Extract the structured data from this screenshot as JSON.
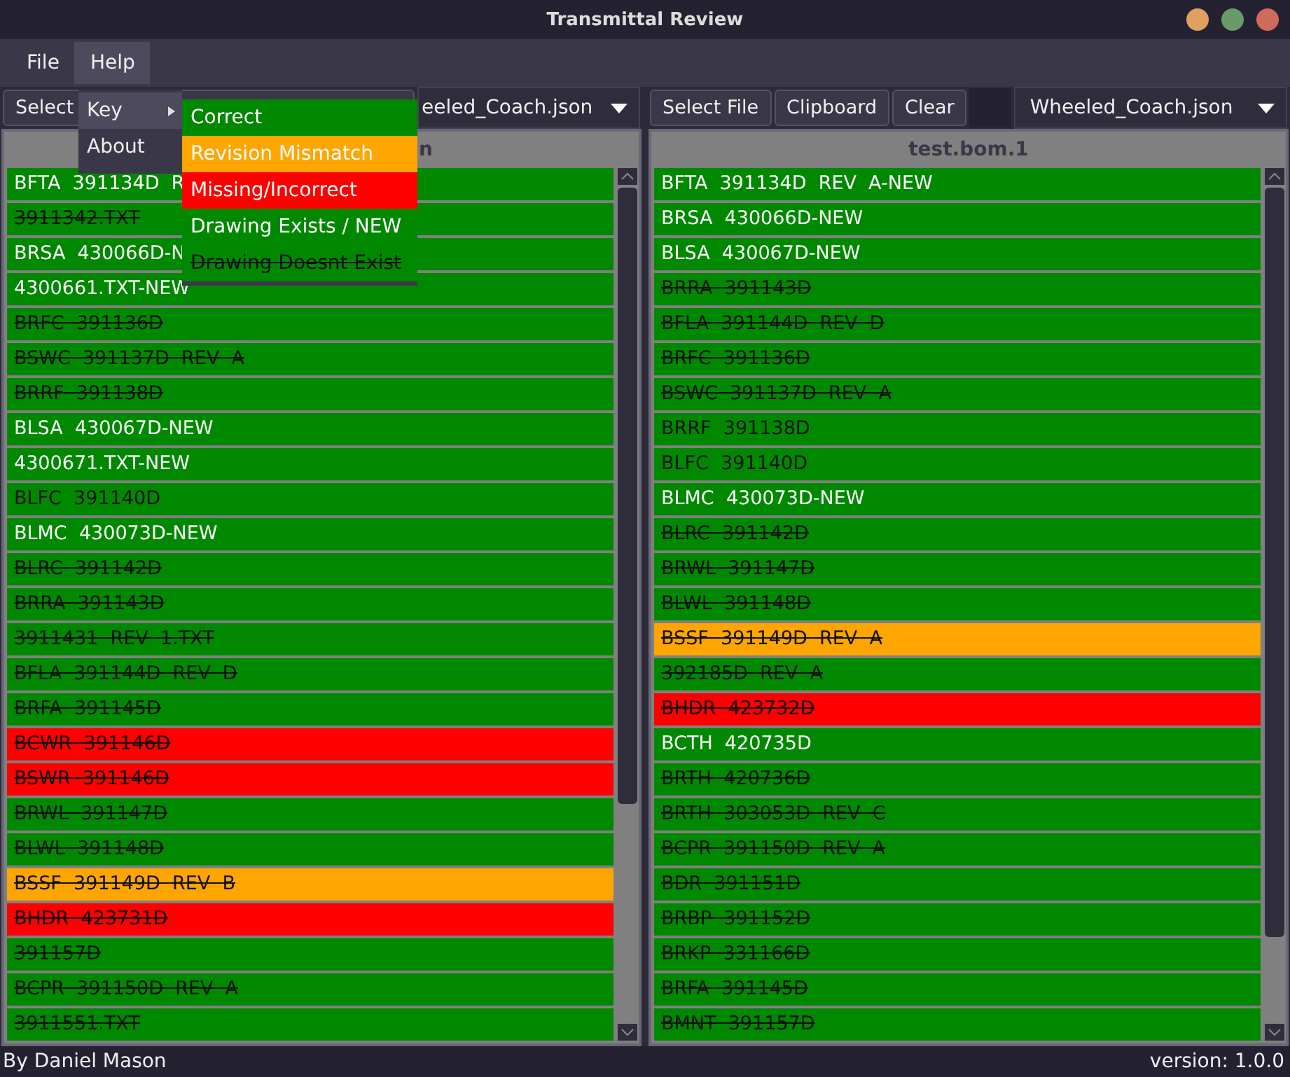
{
  "window": {
    "title": "Transmittal Review"
  },
  "menu": [
    {
      "label": "File",
      "selected": false
    },
    {
      "label": "Help",
      "selected": true
    }
  ],
  "help_menu": [
    {
      "label": "Key",
      "submenu": true,
      "selected": true
    },
    {
      "label": "About",
      "submenu": false,
      "selected": false
    }
  ],
  "key_submenu": [
    {
      "label": "Correct",
      "color": "#008800",
      "kind": "new"
    },
    {
      "label": "Revision Mismatch",
      "color": "#ffa500",
      "kind": "new"
    },
    {
      "label": "Missing/Incorrect",
      "color": "#ff0000",
      "kind": "new"
    },
    {
      "label": "Drawing Exists / NEW",
      "color": "#008800",
      "kind": "new"
    },
    {
      "label": "Drawing Doesnt Exist",
      "color": "#008800",
      "kind": "struck"
    }
  ],
  "left": {
    "buttons": [
      "Select"
    ],
    "file_select": "eeled_Coach.json",
    "header": "n",
    "rows": [
      {
        "text": "BFTA  391134D  R",
        "color": "#008800",
        "kind": "new"
      },
      {
        "text": "3911342.TXT",
        "color": "#008800",
        "kind": "struck"
      },
      {
        "text": "BRSA  430066D-N",
        "color": "#008800",
        "kind": "new"
      },
      {
        "text": "4300661.TXT-NEW",
        "color": "#008800",
        "kind": "new"
      },
      {
        "text": "BRFC  391136D",
        "color": "#008800",
        "kind": "struck"
      },
      {
        "text": "BSWC  391137D  REV  A",
        "color": "#008800",
        "kind": "struck"
      },
      {
        "text": "BRRF  391138D",
        "color": "#008800",
        "kind": "struck"
      },
      {
        "text": "BLSA  430067D-NEW",
        "color": "#008800",
        "kind": "new"
      },
      {
        "text": "4300671.TXT-NEW",
        "color": "#008800",
        "kind": "new"
      },
      {
        "text": "BLFC  391140D",
        "color": "#008800",
        "kind": "plain"
      },
      {
        "text": "BLMC  430073D-NEW",
        "color": "#008800",
        "kind": "new"
      },
      {
        "text": "BLRC  391142D",
        "color": "#008800",
        "kind": "struck"
      },
      {
        "text": "BRRA  391143D",
        "color": "#008800",
        "kind": "struck"
      },
      {
        "text": "3911431  REV  1.TXT",
        "color": "#008800",
        "kind": "struck"
      },
      {
        "text": "BFLA  391144D  REV  D",
        "color": "#008800",
        "kind": "struck"
      },
      {
        "text": "BRFA  391145D",
        "color": "#008800",
        "kind": "struck"
      },
      {
        "text": "BCWR  391146D",
        "color": "#ff0000",
        "kind": "struck"
      },
      {
        "text": "BSWR  391146D",
        "color": "#ff0000",
        "kind": "struck"
      },
      {
        "text": "BRWL  391147D",
        "color": "#008800",
        "kind": "struck"
      },
      {
        "text": "BLWL  391148D",
        "color": "#008800",
        "kind": "struck"
      },
      {
        "text": "BSSF  391149D  REV  B",
        "color": "#ffa500",
        "kind": "struck"
      },
      {
        "text": "BHDR  423731D",
        "color": "#ff0000",
        "kind": "struck"
      },
      {
        "text": "391157D",
        "color": "#008800",
        "kind": "struck"
      },
      {
        "text": "BCPR  391150D  REV  A",
        "color": "#008800",
        "kind": "struck"
      },
      {
        "text": "3911551.TXT",
        "color": "#008800",
        "kind": "struck"
      }
    ]
  },
  "right": {
    "buttons": [
      "Select File",
      "Clipboard",
      "Clear"
    ],
    "file_select": "Wheeled_Coach.json",
    "header": "test.bom.1",
    "rows": [
      {
        "text": "BFTA  391134D  REV  A-NEW",
        "color": "#008800",
        "kind": "new"
      },
      {
        "text": "BRSA  430066D-NEW",
        "color": "#008800",
        "kind": "new"
      },
      {
        "text": "BLSA  430067D-NEW",
        "color": "#008800",
        "kind": "new"
      },
      {
        "text": "BRRA  391143D",
        "color": "#008800",
        "kind": "struck"
      },
      {
        "text": "BFLA  391144D  REV  D",
        "color": "#008800",
        "kind": "struck"
      },
      {
        "text": "BRFC  391136D",
        "color": "#008800",
        "kind": "struck"
      },
      {
        "text": "BSWC  391137D  REV  A",
        "color": "#008800",
        "kind": "struck"
      },
      {
        "text": "BRRF  391138D",
        "color": "#008800",
        "kind": "plain"
      },
      {
        "text": "BLFC  391140D",
        "color": "#008800",
        "kind": "plain"
      },
      {
        "text": "BLMC  430073D-NEW",
        "color": "#008800",
        "kind": "new"
      },
      {
        "text": "BLRC  391142D",
        "color": "#008800",
        "kind": "struck"
      },
      {
        "text": "BRWL  391147D",
        "color": "#008800",
        "kind": "struck"
      },
      {
        "text": "BLWL  391148D",
        "color": "#008800",
        "kind": "struck"
      },
      {
        "text": "BSSF  391149D  REV  A",
        "color": "#ffa500",
        "kind": "struck"
      },
      {
        "text": "392185D  REV  A",
        "color": "#008800",
        "kind": "struck"
      },
      {
        "text": "BHDR  423732D",
        "color": "#ff0000",
        "kind": "struck"
      },
      {
        "text": "BCTH  420735D",
        "color": "#008800",
        "kind": "new"
      },
      {
        "text": "BRTH  420736D",
        "color": "#008800",
        "kind": "struck"
      },
      {
        "text": "BRTH  303053D  REV  C",
        "color": "#008800",
        "kind": "struck"
      },
      {
        "text": "BCPR  391150D  REV  A",
        "color": "#008800",
        "kind": "struck"
      },
      {
        "text": "BDR  391151D",
        "color": "#008800",
        "kind": "struck"
      },
      {
        "text": "BRBP  391152D",
        "color": "#008800",
        "kind": "struck"
      },
      {
        "text": "BRKP  331166D",
        "color": "#008800",
        "kind": "struck"
      },
      {
        "text": "BRFA  391145D",
        "color": "#008800",
        "kind": "struck"
      },
      {
        "text": "BMNT  391157D",
        "color": "#008800",
        "kind": "struck"
      }
    ]
  },
  "status_bar": {
    "author": "By Daniel Mason",
    "version": "version: 1.0.0"
  }
}
